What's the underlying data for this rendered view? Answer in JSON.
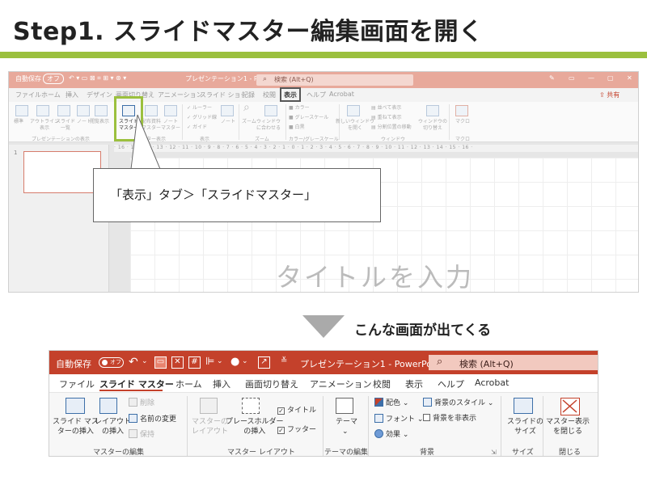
{
  "heading": "Step1. スライドマスター編集画面を開く",
  "colors": {
    "accent_green": "#9bc03e",
    "ppt_red": "#c4412b",
    "ppt_red_faded": "#e8a99b"
  },
  "top_window": {
    "autosave_label": "自動保存",
    "autosave_state": "オフ",
    "file_name": "プレゼンテーション1 - PowerPoint",
    "search_placeholder": "検索 (Alt+Q)",
    "tabs": [
      "ファイル",
      "ホーム",
      "挿入",
      "デザイン",
      "画面切り替え",
      "アニメーション",
      "スライド ショー",
      "記録",
      "校閲",
      "表示",
      "ヘルプ",
      "Acrobat"
    ],
    "share_label": "共有",
    "ribbon_buttons": [
      {
        "label": "標準"
      },
      {
        "label": "アウトライン\n表示"
      },
      {
        "label": "スライド\n一覧"
      },
      {
        "label": "ノート"
      },
      {
        "label": "閲覧表示"
      },
      {
        "label": "スライド\nマスター"
      },
      {
        "label": "配布資料\nマスター"
      },
      {
        "label": "ノート\nマスター"
      },
      {
        "label": "ノート"
      },
      {
        "label": "ズーム"
      },
      {
        "label": "ウィンドウ\nに合わせる"
      },
      {
        "label": "新しいウィンドウ\nを開く"
      },
      {
        "label": "ウィンドウの\n切り替え"
      },
      {
        "label": "マクロ"
      }
    ],
    "show_checks": [
      "ルーラー",
      "グリッド線",
      "ガイド"
    ],
    "color_items": [
      "カラー",
      "グレースケール",
      "白黒"
    ],
    "window_items": [
      "並べて表示",
      "重ねて表示",
      "分割位置の移動"
    ],
    "group_labels": [
      "プレゼンテーションの表示",
      "マスター表示",
      "表示",
      "ズーム",
      "カラー/グレースケール",
      "ウィンドウ",
      "マクロ"
    ],
    "ruler_text": "· 16 · 15 · 14 · 13 · 12 · 11 · 10 · 9 · 8 · 7 · 6 · 5 · 4 · 3 · 2 · 1 · 0 · 1 · 2 · 3 · 4 · 5 · 6 · 7 · 8 · 9 · 10 · 11 · 12 · 13 · 14 · 15 · 16 ·",
    "slide_number": "1",
    "title_placeholder": "タイトルを入力"
  },
  "callout": "「表示」タブ＞「スライドマスター」",
  "caption": "こんな画面が出てくる",
  "bottom_window": {
    "autosave_label": "自動保存",
    "autosave_state": "オフ",
    "file_name": "プレゼンテーション1 - PowerPoint",
    "search_placeholder": "検索 (Alt+Q)",
    "tabs": [
      "ファイル",
      "スライド マスター",
      "ホーム",
      "挿入",
      "画面切り替え",
      "アニメーション",
      "校閲",
      "表示",
      "ヘルプ",
      "Acrobat"
    ],
    "groups": {
      "master_edit": {
        "label": "マスターの編集",
        "insert_master": "スライド マス\nターの挿入",
        "insert_layout": "レイアウト\nの挿入",
        "delete": "削除",
        "rename": "名前の変更",
        "preserve": "保持"
      },
      "master_layout": {
        "label": "マスター レイアウト",
        "master_layout_btn": "マスターの\nレイアウト",
        "insert_placeholder": "プレースホルダー\nの挿入",
        "title_check": "タイトル",
        "footer_check": "フッター"
      },
      "theme_edit": {
        "label": "テーマの編集",
        "theme_btn": "テーマ"
      },
      "background": {
        "label": "背景",
        "colors": "配色",
        "fonts": "フォント",
        "effects": "効果",
        "bg_styles": "背景のスタイル",
        "hide_bg": "背景を非表示"
      },
      "size": {
        "label": "サイズ",
        "slide_size": "スライドの\nサイズ"
      },
      "close": {
        "label": "閉じる",
        "close_master": "マスター表示\nを閉じる"
      }
    }
  }
}
